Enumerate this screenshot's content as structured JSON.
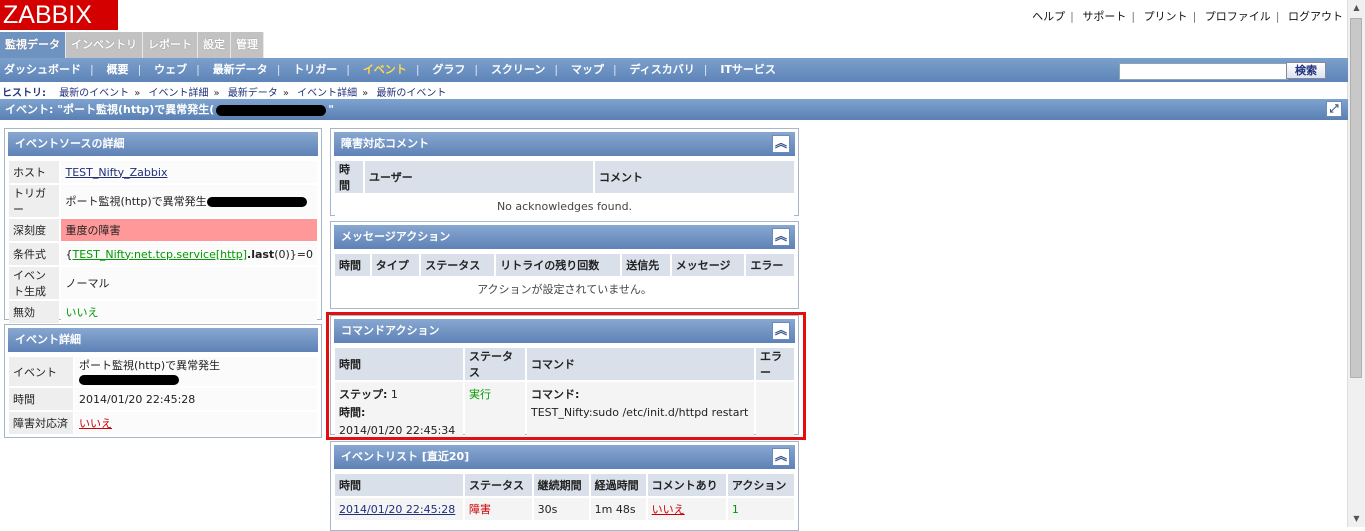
{
  "header": {
    "logo": "ZABBIX",
    "links": [
      "ヘルプ",
      "サポート",
      "プリント",
      "プロファイル",
      "ログアウト"
    ]
  },
  "main_tabs": [
    {
      "label": "監視データ",
      "active": true
    },
    {
      "label": "インベントリ",
      "active": false
    },
    {
      "label": "レポート",
      "active": false
    },
    {
      "label": "設定",
      "active": false
    },
    {
      "label": "管理",
      "active": false
    }
  ],
  "submenu": {
    "items": [
      {
        "label": "ダッシュボード",
        "active": false
      },
      {
        "label": "概要",
        "active": false
      },
      {
        "label": "ウェブ",
        "active": false
      },
      {
        "label": "最新データ",
        "active": false
      },
      {
        "label": "トリガー",
        "active": false
      },
      {
        "label": "イベント",
        "active": true
      },
      {
        "label": "グラフ",
        "active": false
      },
      {
        "label": "スクリーン",
        "active": false
      },
      {
        "label": "マップ",
        "active": false
      },
      {
        "label": "ディスカバリ",
        "active": false
      },
      {
        "label": "ITサービス",
        "active": false
      }
    ],
    "search_value": "",
    "search_button": "検索"
  },
  "history": {
    "label": "ヒストリ:",
    "items": [
      "最新のイベント",
      "イベント詳細",
      "最新データ",
      "イベント詳細",
      "最新のイベント"
    ]
  },
  "page_title": {
    "prefix": "イベント: \"ポート監視(http)で異常発生(",
    "suffix": "\""
  },
  "source_details": {
    "title": "イベントソースの詳細",
    "rows": {
      "host_label": "ホスト",
      "host_value": "TEST_Nifty_Zabbix",
      "trigger_label": "トリガー",
      "trigger_value": "ポート監視(http)で異常発生",
      "severity_label": "深刻度",
      "severity_value": "重度の障害",
      "expr_label": "条件式",
      "expr_open": "{",
      "expr_link": "TEST_Nifty:net.tcp.service[http]",
      "expr_func": ".last",
      "expr_close": "(0)}=0",
      "gen_label": "イベント生成",
      "gen_value": "ノーマル",
      "disabled_label": "無効",
      "disabled_value": "いいえ"
    }
  },
  "event_details": {
    "title": "イベント詳細",
    "rows": {
      "event_label": "イベント",
      "event_value": "ポート監視(http)で異常発生",
      "time_label": "時間",
      "time_value": "2014/01/20 22:45:28",
      "ack_label": "障害対応済",
      "ack_value": "いいえ"
    }
  },
  "ack_widget": {
    "title": "障害対応コメント",
    "columns": [
      "時間",
      "ユーザー",
      "コメント"
    ],
    "empty": "No acknowledges found."
  },
  "message_actions": {
    "title": "メッセージアクション",
    "columns": [
      "時間",
      "タイプ",
      "ステータス",
      "リトライの残り回数",
      "送信先",
      "メッセージ",
      "エラー"
    ],
    "empty": "アクションが設定されていません。"
  },
  "command_actions": {
    "title": "コマンドアクション",
    "columns": [
      "時間",
      "ステータス",
      "コマンド",
      "エラー"
    ],
    "row": {
      "step_label": "ステップ:",
      "step_value": "1",
      "time_label": "時間:",
      "time_value": "2014/01/20 22:45:34",
      "status": "実行",
      "command_label": "コマンド:",
      "command_value": "TEST_Nifty:sudo /etc/init.d/httpd restart",
      "error": ""
    }
  },
  "event_list": {
    "title": "イベントリスト [直近20]",
    "columns": [
      "時間",
      "ステータス",
      "継続期間",
      "経過時間",
      "コメントあり",
      "アクション"
    ],
    "rows": [
      {
        "time": "2014/01/20 22:45:28",
        "status": "障害",
        "duration": "30s",
        "age": "1m 48s",
        "ack": "いいえ",
        "actions": "1"
      }
    ]
  },
  "colors": {
    "accent": "#6f93c1",
    "problem": "#cc0000",
    "ok": "#009900",
    "severity_bg": "#ff9999",
    "highlight_box": "#e01010"
  }
}
